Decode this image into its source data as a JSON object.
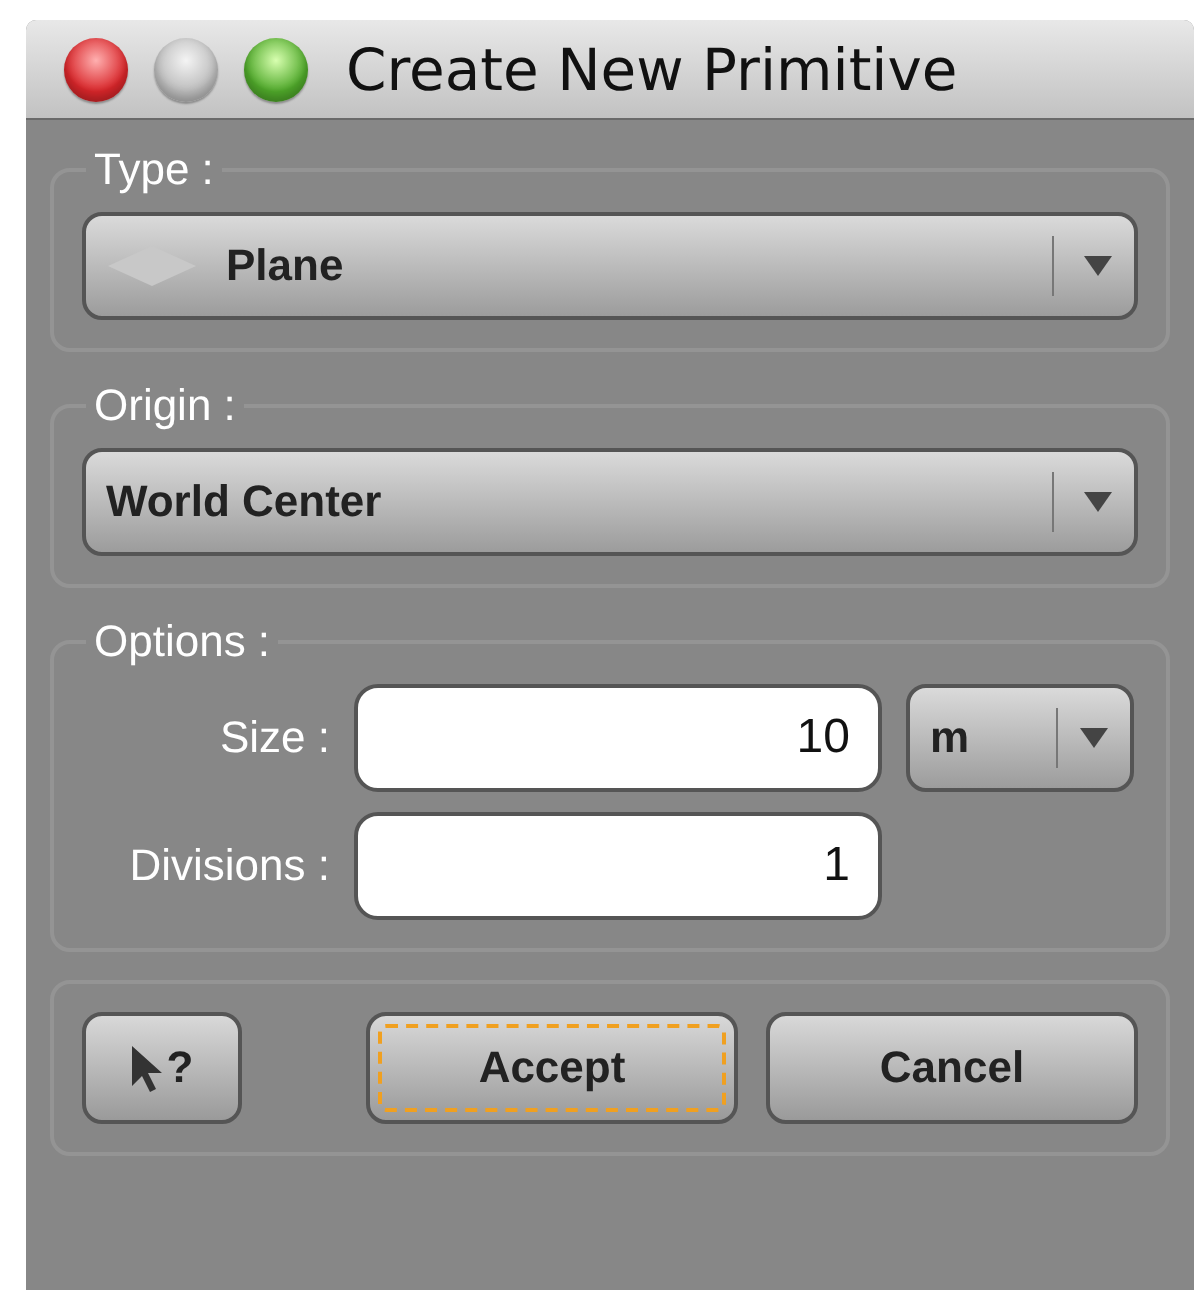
{
  "window": {
    "title": "Create New Primitive",
    "controls": [
      {
        "kind": "close"
      },
      {
        "kind": "minimize"
      },
      {
        "kind": "zoom"
      }
    ]
  },
  "type_group": {
    "legend": "Type :",
    "dropdown": {
      "value": "Plane",
      "kind": "plane"
    }
  },
  "origin_group": {
    "legend": "Origin :",
    "dropdown": {
      "value": "World Center"
    }
  },
  "options_group": {
    "legend": "Options :",
    "fields": [
      {
        "label": "Size :",
        "value": "10",
        "unit": "m"
      },
      {
        "label": "Divisions :",
        "value": "1"
      }
    ]
  },
  "buttons": [
    {
      "kind": "help",
      "label": "?",
      "focused": false
    },
    {
      "kind": "text",
      "label": "Accept",
      "focused": true
    },
    {
      "kind": "text",
      "label": "Cancel",
      "focused": false
    }
  ]
}
